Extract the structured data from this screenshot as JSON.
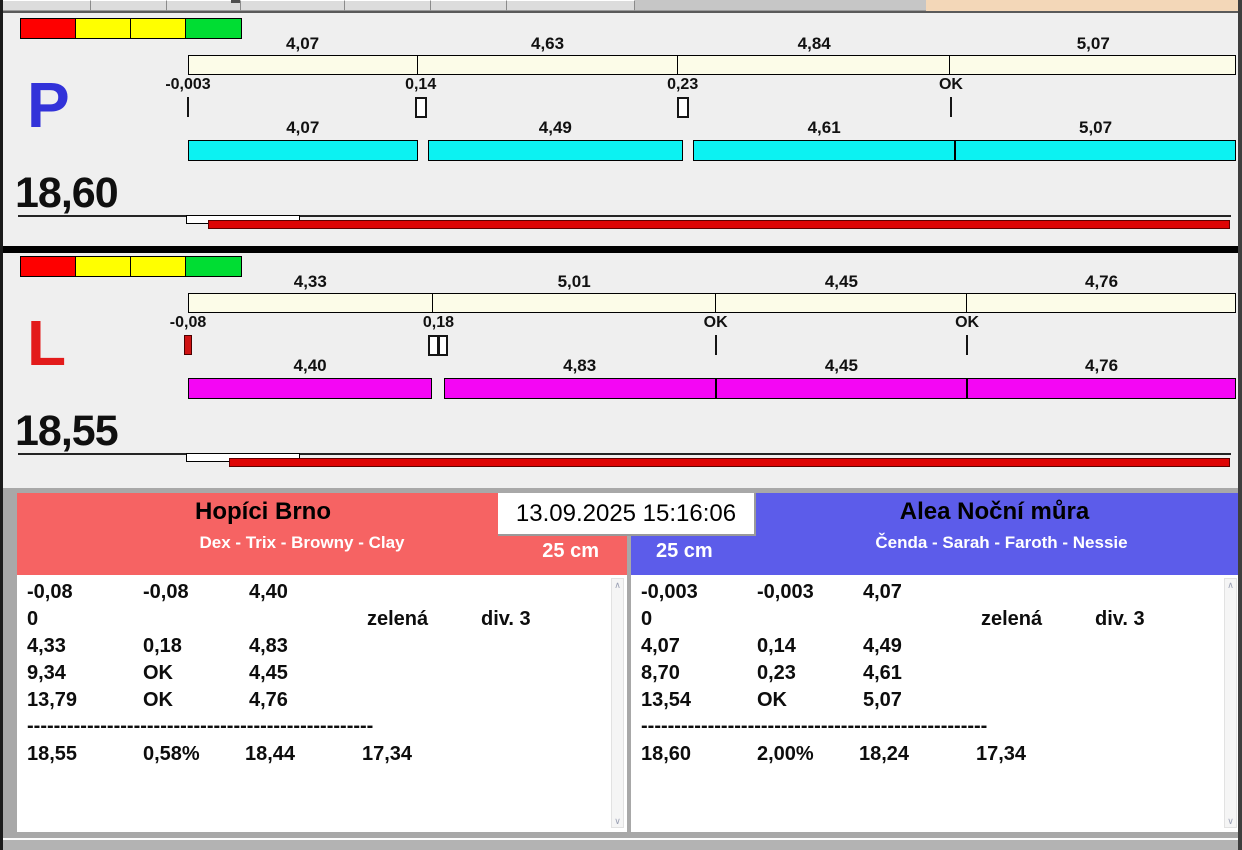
{
  "icons": {
    "scroll_up": "∧",
    "scroll_down": "∨"
  },
  "top_strip": {
    "segment_widths": [
      88,
      76,
      74,
      104,
      86,
      76,
      128
    ],
    "peach_color": "#f3d7b8"
  },
  "lanes": [
    {
      "letter": "P",
      "letter_color": "#3232d9",
      "total": "18,60",
      "legend_colors": [
        "#fe0000",
        "#ffff00",
        "#ffff00",
        "#00dd33"
      ],
      "bottom_bar_color": "#0cf2f2",
      "top_segments": [
        {
          "label": "4,07",
          "width_pct": 21.87
        },
        {
          "label": "4,63",
          "width_pct": 24.88
        },
        {
          "label": "4,84",
          "width_pct": 26.01
        },
        {
          "label": "5,07",
          "width_pct": 27.24
        }
      ],
      "markers": [
        {
          "label": "-0,003",
          "pos_pct": 0,
          "type": "tick"
        },
        {
          "label": "0,14",
          "pos_pct": 22.2,
          "type": "box"
        },
        {
          "label": "0,23",
          "pos_pct": 47.2,
          "type": "box"
        },
        {
          "label": "OK",
          "pos_pct": 72.8,
          "type": "tick"
        }
      ],
      "bottom_segments": [
        {
          "label": "4,07",
          "start_pct": 0,
          "end_pct": 21.9
        },
        {
          "label": "4,49",
          "start_pct": 22.9,
          "end_pct": 47.2
        },
        {
          "label": "4,61",
          "start_pct": 48.2,
          "end_pct": 73.2
        },
        {
          "label": "5,07",
          "start_pct": 73.2,
          "end_pct": 100
        }
      ]
    },
    {
      "letter": "L",
      "letter_color": "#e31b1b",
      "total": "18,55",
      "legend_colors": [
        "#fe0000",
        "#ffff00",
        "#ffff00",
        "#00dd33"
      ],
      "bottom_bar_color": "#f406f4",
      "top_segments": [
        {
          "label": "4,33",
          "width_pct": 23.34
        },
        {
          "label": "5,01",
          "width_pct": 27.01
        },
        {
          "label": "4,45",
          "width_pct": 23.99
        },
        {
          "label": "4,76",
          "width_pct": 25.66
        }
      ],
      "markers": [
        {
          "label": "-0,08",
          "pos_pct": 0,
          "type": "red-tick"
        },
        {
          "label": "0,18",
          "pos_pct": 23.9,
          "type": "double-box"
        },
        {
          "label": "OK",
          "pos_pct": 50.35,
          "type": "tick"
        },
        {
          "label": "OK",
          "pos_pct": 74.34,
          "type": "tick"
        }
      ],
      "bottom_segments": [
        {
          "label": "4,40",
          "start_pct": 0,
          "end_pct": 23.3
        },
        {
          "label": "4,83",
          "start_pct": 24.4,
          "end_pct": 50.35
        },
        {
          "label": "4,45",
          "start_pct": 50.35,
          "end_pct": 74.34
        },
        {
          "label": "4,76",
          "start_pct": 74.34,
          "end_pct": 100
        }
      ]
    }
  ],
  "scoreboard": {
    "datetime": "13.09.2025 15:16:06",
    "teams": [
      {
        "name": "Hopíci Brno",
        "dogs": "Dex - Trix - Browny - Clay",
        "category": "25 cm",
        "header_color": "#f66363",
        "rows": [
          [
            "-0,08",
            "-0,08",
            "4,40",
            "",
            ""
          ],
          [
            "0",
            "",
            "",
            "zelená",
            "div. 3"
          ],
          [
            "4,33",
            "0,18",
            "4,83",
            "",
            ""
          ],
          [
            "9,34",
            "OK",
            "4,45",
            "",
            ""
          ],
          [
            "13,79",
            "OK",
            "4,76",
            "",
            ""
          ]
        ],
        "separator": "----------------------------------------------------",
        "totals": [
          "18,55",
          "0,58%",
          "18,44",
          "17,34"
        ]
      },
      {
        "name": "Alea Noční můra",
        "dogs": "Čenda - Sarah - Faroth - Nessie",
        "category": "25 cm",
        "header_color": "#5c5cea",
        "rows": [
          [
            "-0,003",
            "-0,003",
            "4,07",
            "",
            ""
          ],
          [
            "0",
            "",
            "",
            "zelená",
            "div. 3"
          ],
          [
            "4,07",
            "0,14",
            "4,49",
            "",
            ""
          ],
          [
            "8,70",
            "0,23",
            "4,61",
            "",
            ""
          ],
          [
            "13,54",
            "OK",
            "5,07",
            "",
            ""
          ]
        ],
        "separator": "----------------------------------------------------",
        "totals": [
          "18,60",
          "2,00%",
          "18,24",
          "17,34"
        ]
      }
    ]
  }
}
